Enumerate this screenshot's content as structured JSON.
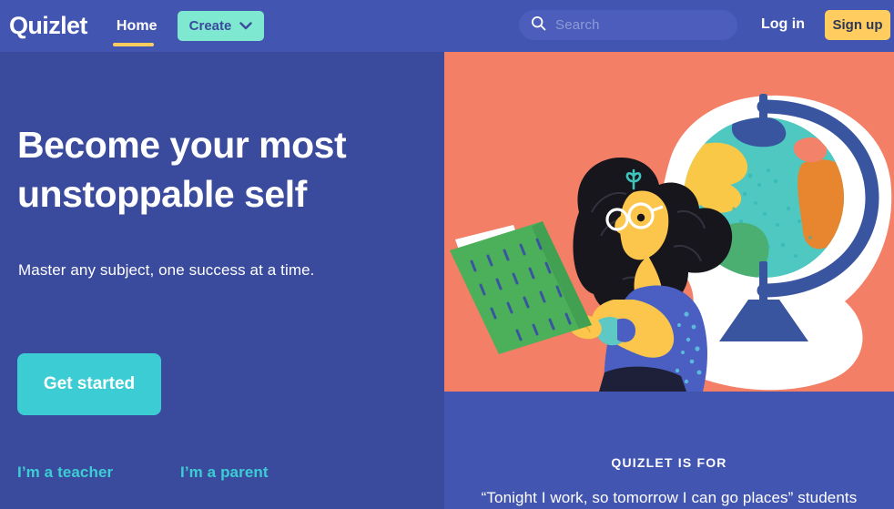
{
  "header": {
    "logo": "Quizlet",
    "nav_home": "Home",
    "create_label": "Create",
    "login_label": "Log in",
    "signup_label": "Sign up",
    "search_placeholder": "Search",
    "search_value": "",
    "icons": {
      "search": "search-icon",
      "chevron": "chevron-down-icon"
    },
    "colors": {
      "bar_background": "#4255b0",
      "create_button": "#7fe8d0",
      "signup_button": "#ffcd5f",
      "home_underline": "#ffcd5f",
      "search_field": "#4c5dbb"
    }
  },
  "hero": {
    "title_line_1": "Become your most",
    "title_line_2": "unstoppable self",
    "subtitle": "Master any subject, one success at a time.",
    "cta_label": "Get started",
    "teacher_link": "I’m a teacher",
    "parent_link": "I’m a parent",
    "colors": {
      "background": "#3a4b9d",
      "cta_button": "#3ccdd4",
      "role_link": "#3ccdd4"
    }
  },
  "illustration": {
    "name": "student-reading-with-globe",
    "background": "#f37f66",
    "palette": {
      "coral": "#f37f66",
      "white": "#ffffff",
      "navy": "#3a55a0",
      "teal": "#2bbfb3",
      "light_teal": "#5ec9c4",
      "yellow": "#f9c846",
      "skin_yellow": "#fbc64b",
      "green": "#4caf72",
      "book_green": "#4caf5a",
      "orange": "#e8852f",
      "shirt_blue": "#4a5fc1",
      "hair_black": "#16161c"
    }
  },
  "quote_panel": {
    "kicker": "QUIZLET IS FOR",
    "quote": "“Tonight I work, so tomorrow I can go places” students",
    "background": "#4255b0"
  }
}
